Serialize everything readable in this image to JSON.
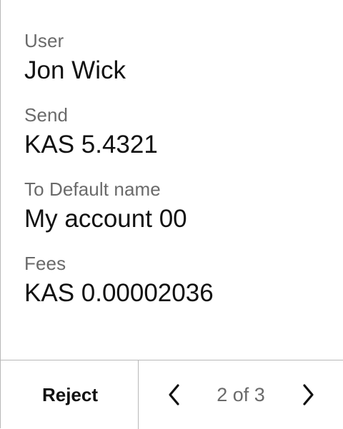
{
  "fields": [
    {
      "label": "User",
      "value": "Jon Wick"
    },
    {
      "label": "Send",
      "value": "KAS 5.4321"
    },
    {
      "label": "To Default name",
      "value": "My account 00"
    },
    {
      "label": "Fees",
      "value": "KAS 0.00002036"
    }
  ],
  "footer": {
    "reject_label": "Reject",
    "pager_text": "2 of 3",
    "prev_icon": "chevron-left-icon",
    "next_icon": "chevron-right-icon"
  },
  "colors": {
    "background": "#ffffff",
    "label_text": "#6a6a6a",
    "value_text": "#111111",
    "divider": "#b8b8b8"
  }
}
